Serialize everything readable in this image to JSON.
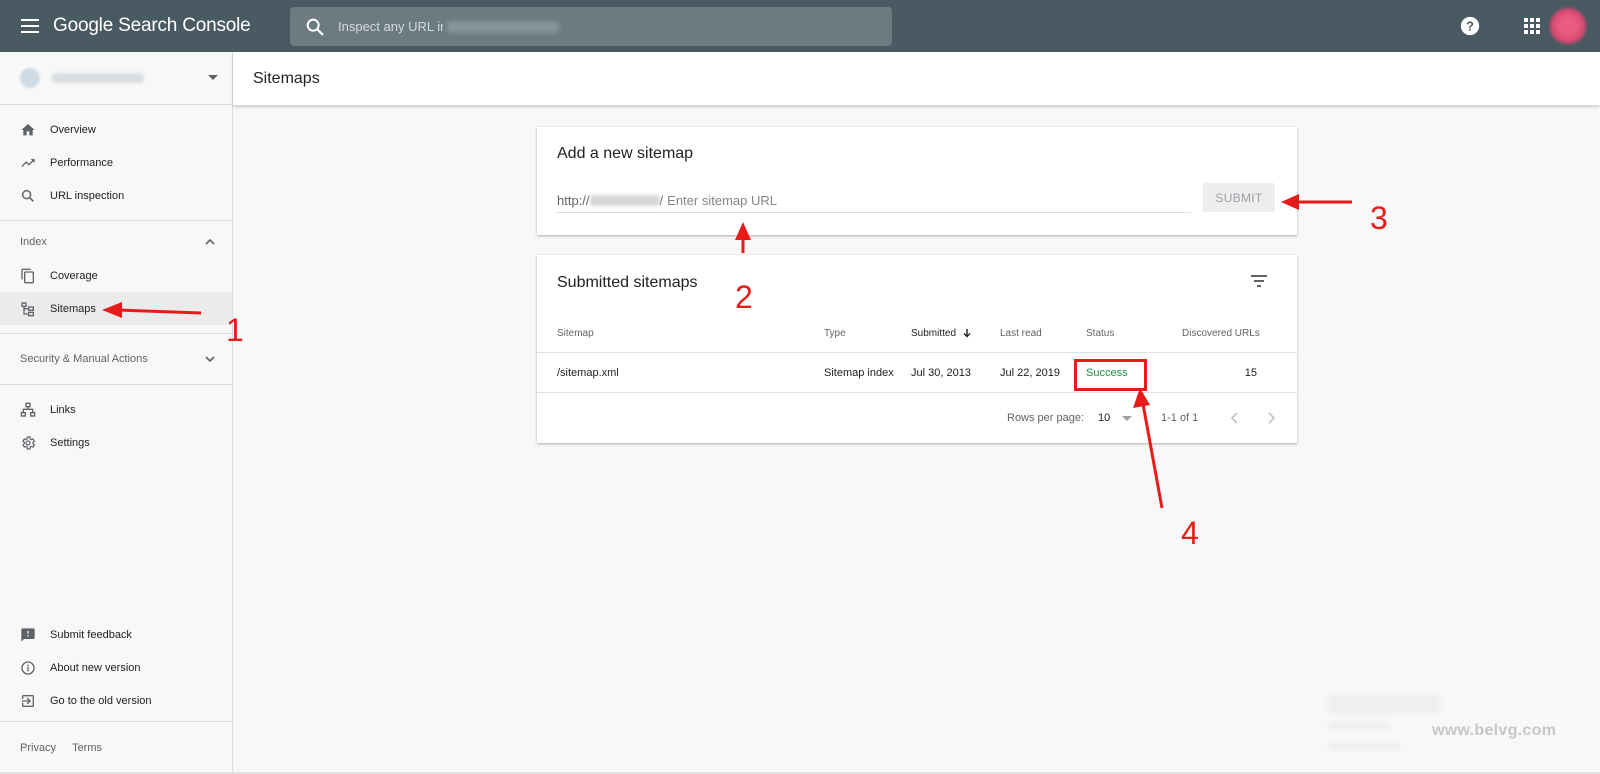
{
  "topbar": {
    "app_title": "Google Search Console",
    "search_placeholder": "Inspect any URL in"
  },
  "sidebar": {
    "items_main": [
      {
        "label": "Overview",
        "icon": "home-icon"
      },
      {
        "label": "Performance",
        "icon": "trending-up-icon"
      },
      {
        "label": "URL inspection",
        "icon": "search-icon"
      }
    ],
    "index_section": "Index",
    "index_items": [
      {
        "label": "Coverage",
        "icon": "copy-icon"
      },
      {
        "label": "Sitemaps",
        "icon": "sitemap-icon"
      }
    ],
    "security_section": "Security & Manual Actions",
    "items_links": [
      {
        "label": "Links",
        "icon": "links-icon"
      },
      {
        "label": "Settings",
        "icon": "gear-icon"
      }
    ],
    "bottom_items": [
      {
        "label": "Submit feedback",
        "icon": "feedback-icon"
      },
      {
        "label": "About new version",
        "icon": "info-icon"
      },
      {
        "label": "Go to the old version",
        "icon": "exit-icon"
      }
    ],
    "footer": {
      "privacy": "Privacy",
      "terms": "Terms"
    }
  },
  "header": {
    "title": "Sitemaps"
  },
  "add_sitemap": {
    "title": "Add a new sitemap",
    "prefix_start": "http://",
    "prefix_end": "/",
    "placeholder": "Enter sitemap URL",
    "submit_label": "SUBMIT"
  },
  "submitted": {
    "title": "Submitted sitemaps",
    "columns": {
      "sitemap": "Sitemap",
      "type": "Type",
      "submitted": "Submitted",
      "last_read": "Last read",
      "status": "Status",
      "discovered": "Discovered URLs"
    },
    "rows": [
      {
        "sitemap": "/sitemap.xml",
        "type": "Sitemap index",
        "submitted": "Jul 30, 2013",
        "last_read": "Jul 22, 2019",
        "status": "Success",
        "discovered": "15"
      }
    ],
    "pager": {
      "rows_per_page_label": "Rows per page:",
      "rows_per_page_value": "10",
      "range": "1-1 of 1"
    }
  },
  "annotations": {
    "n1": "1",
    "n2": "2",
    "n3": "3",
    "n4": "4"
  },
  "watermark": "www.belvg.com",
  "colors": {
    "topbar": "#4a5a63",
    "success": "#1e8e3e",
    "annotation": "#e81a1a"
  }
}
